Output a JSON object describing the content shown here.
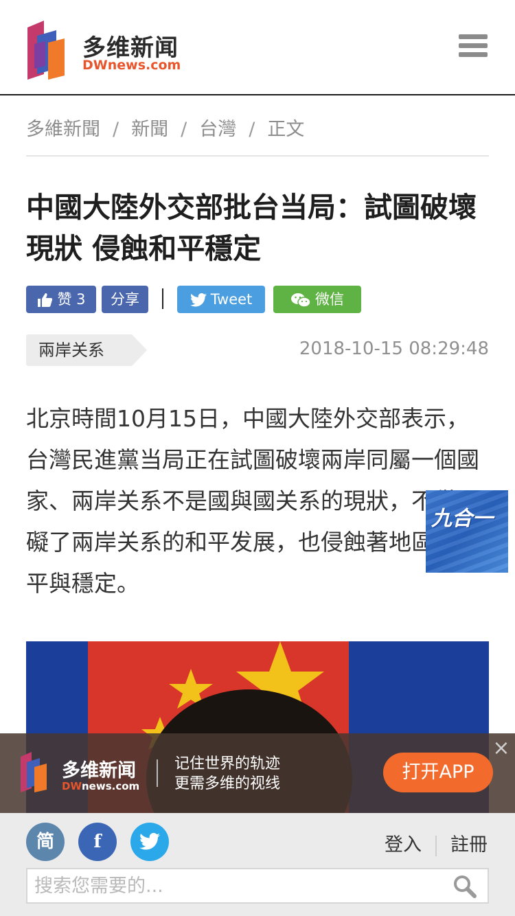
{
  "header": {
    "logo_cn": "多维新闻",
    "logo_en_dw": "DW",
    "logo_en_rest": "news.com"
  },
  "breadcrumb": {
    "items": [
      "多維新聞",
      "新聞",
      "台灣",
      "正文"
    ],
    "separator": "/"
  },
  "article": {
    "title": "中國大陸外交部批台当局：試圖破壞現狀 侵蝕和平穩定",
    "category": "兩岸关系",
    "datetime": "2018-10-15 08:29:48",
    "body": "北京時間10月15日，中國大陸外交部表示，台灣民進黨当局正在試圖破壞兩岸同屬一個國家、兩岸关系不是國與國关系的現狀，不僅阻礙了兩岸关系的和平发展，也侵蝕著地區的和平與穩定。"
  },
  "share": {
    "like_label": "赞",
    "like_count": "3",
    "share_label": "分享",
    "tweet_label": "Tweet",
    "wechat_label": "微信"
  },
  "float_ad": {
    "text": "九合一"
  },
  "app_banner": {
    "name": "多维新闻",
    "sub_dw": "DW",
    "sub_rest": "news.com",
    "slogan_line1": "记住世界的轨迹",
    "slogan_line2": "更需多维的视线",
    "open_label": "打开APP",
    "close_symbol": "×"
  },
  "footer": {
    "simplified_label": "简",
    "facebook_label": "f",
    "login_label": "登入",
    "register_label": "註冊",
    "search_placeholder": "搜索您需要的..."
  },
  "colors": {
    "brand_orange": "#e8552c",
    "share_blue": "#4a67ad",
    "twitter_blue": "#4b9fe0",
    "wechat_green": "#5fb244",
    "app_button": "#f26a2c"
  }
}
